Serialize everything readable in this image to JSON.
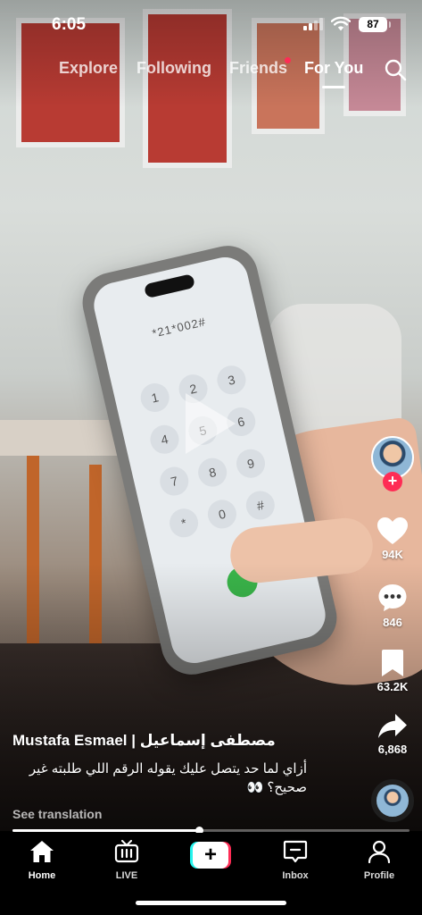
{
  "status_bar": {
    "time": "6:05",
    "battery": "87"
  },
  "top_nav": {
    "tabs": [
      {
        "label": "Explore",
        "active": false
      },
      {
        "label": "Following",
        "active": false
      },
      {
        "label": "Friends",
        "active": false,
        "has_notification_dot": true
      },
      {
        "label": "For You",
        "active": true
      }
    ],
    "search_icon": "search-icon"
  },
  "video": {
    "dial_number": "*21*002#",
    "keypad": [
      "1",
      "2",
      "3",
      "4",
      "5",
      "6",
      "7",
      "8",
      "9",
      "*",
      "0",
      "#"
    ],
    "progress": 0.47
  },
  "actions": {
    "likes": "94K",
    "comments": "846",
    "saves": "63.2K",
    "shares": "6,868"
  },
  "post": {
    "author": "Mustafa Esmael | مصطفى إسماعيل",
    "caption": "أزاي لما حد يتصل عليك يقوله الرقم اللي طلبته غير صحيح؟ 👀",
    "see_translation": "See translation"
  },
  "bottom_nav": {
    "home": "Home",
    "live": "LIVE",
    "inbox": "Inbox",
    "profile": "Profile",
    "create_symbol": "+"
  },
  "colors": {
    "accent_red": "#fe2c55",
    "accent_cyan": "#25f4ee"
  }
}
